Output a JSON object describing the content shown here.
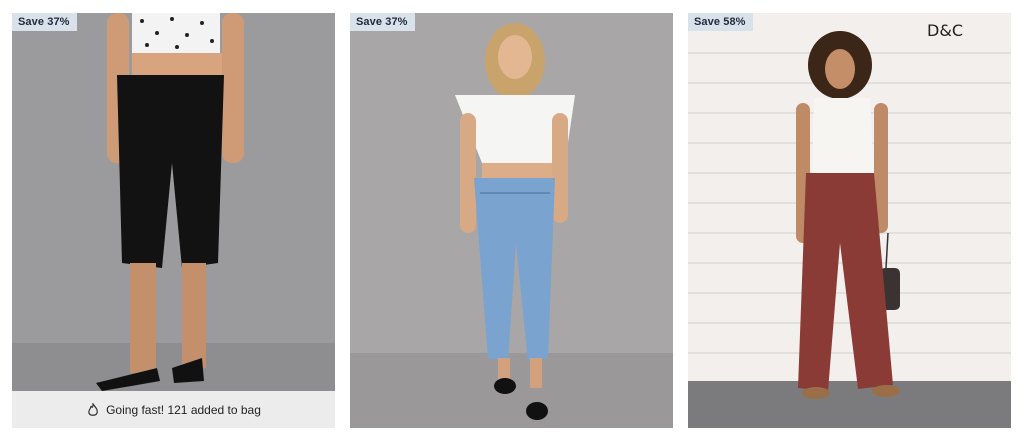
{
  "products": [
    {
      "badge": "Save 37%",
      "image_icon": "black-capri-jeans-photo",
      "promo_icon": "flame-icon",
      "promo_text": "Going fast! 121 added to bag"
    },
    {
      "badge": "Save 37%",
      "image_icon": "light-wash-ankle-jeans-photo"
    },
    {
      "badge": "Save 58%",
      "image_icon": "burgundy-wide-leg-pants-photo",
      "brand": "D&C"
    }
  ],
  "colors": {
    "badge_bg": "#d9e1ea",
    "promo_bg": "#ececec"
  }
}
